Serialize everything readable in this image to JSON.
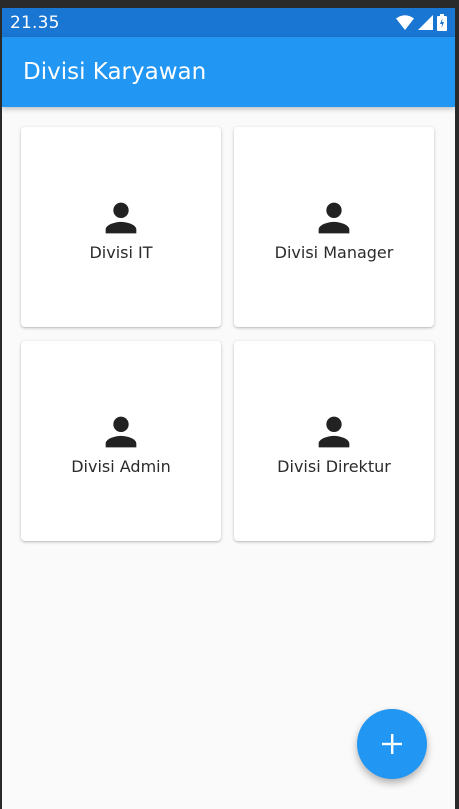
{
  "status_bar": {
    "time": "21.35",
    "icons": [
      "wifi-icon",
      "signal-icon",
      "battery-charging-icon"
    ]
  },
  "app_bar": {
    "title": "Divisi Karyawan",
    "color": "#2196f3"
  },
  "divisions": [
    {
      "label": "Divisi IT",
      "icon": "person-icon"
    },
    {
      "label": "Divisi Manager",
      "icon": "person-icon"
    },
    {
      "label": "Divisi Admin",
      "icon": "person-icon"
    },
    {
      "label": "Divisi Direktur",
      "icon": "person-icon"
    }
  ],
  "fab": {
    "icon": "add-icon",
    "color": "#2196f3"
  }
}
